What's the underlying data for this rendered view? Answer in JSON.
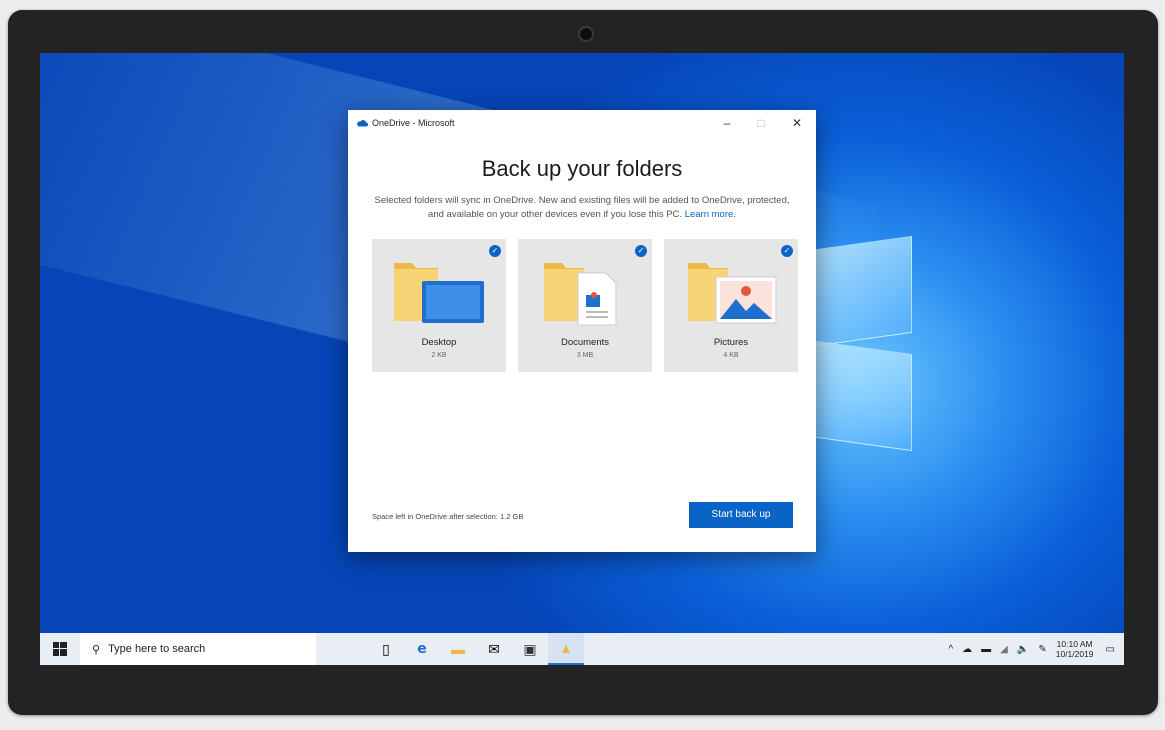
{
  "window": {
    "title": "OneDrive - Microsoft",
    "minimize": "–",
    "maximize": "□",
    "close": "✕"
  },
  "dialog": {
    "heading": "Back up your folders",
    "description": "Selected folders will sync in OneDrive. New and existing files will be added to OneDrive, protected, and available on your other devices even if you lose this PC.",
    "learn_more": "Learn more.",
    "folders": [
      {
        "name": "Desktop",
        "size": "2 KB",
        "selected": true
      },
      {
        "name": "Documents",
        "size": "3 MB",
        "selected": true
      },
      {
        "name": "Pictures",
        "size": "4 KB",
        "selected": true
      }
    ],
    "space_left": "Space left in OneDrive after selection: 1.2 GB",
    "start_button": "Start back up"
  },
  "taskbar": {
    "search_placeholder": "Type here to search",
    "apps": [
      "task-view-icon",
      "edge-icon",
      "file-explorer-icon",
      "mail-icon",
      "store-icon",
      "onedrive-setup-icon"
    ],
    "time": "10:10 AM",
    "date": "10/1/2019"
  },
  "colors": {
    "accent": "#0a64c8",
    "desktop": "#0a5fd8",
    "folder": "#f5cf66"
  }
}
